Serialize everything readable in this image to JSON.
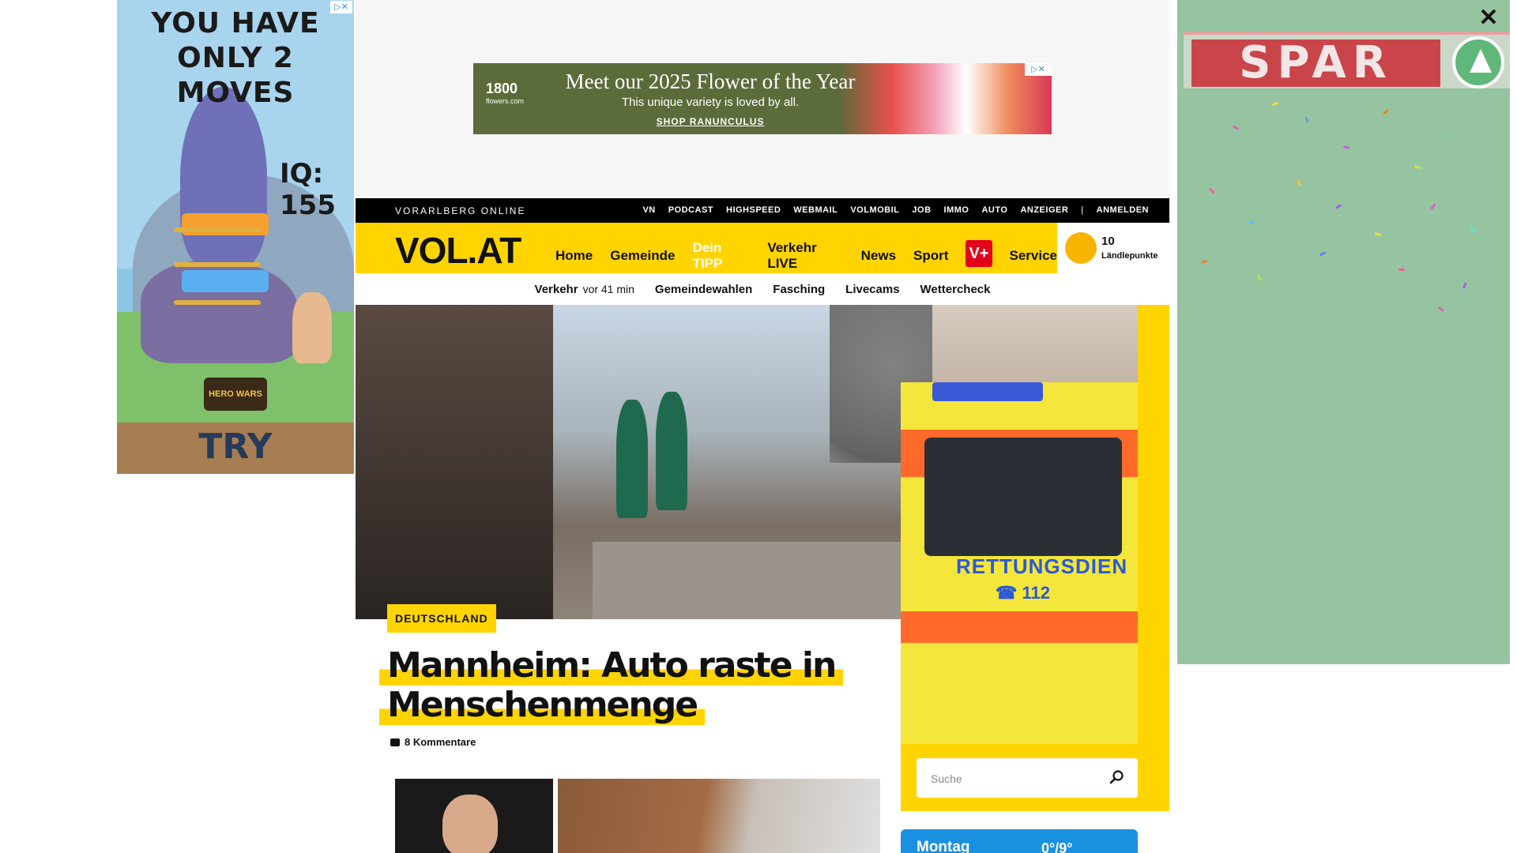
{
  "left_ad": {
    "headline_line1": "YOU HAVE",
    "headline_line2": "ONLY 2 MOVES",
    "iq_text": "IQ: 155",
    "brand": "HERO WARS",
    "cta": "TRY",
    "adchoices": "▷✕"
  },
  "top_banner": {
    "brand": "1800",
    "brand_sub": "flowers.com",
    "title": "Meet our 2025 Flower of the Year",
    "subtitle": "This unique variety is loved by all.",
    "cta": "SHOP RANUNCULUS",
    "adchoices": "▷✕"
  },
  "right_ad": {
    "brand": "SPAR",
    "close_label": "✕"
  },
  "topstrip": {
    "site_name": "VORARLBERG ONLINE",
    "links": [
      "VN",
      "PODCAST",
      "HIGHSPEED",
      "WEBMAIL",
      "VOLMOBIL",
      "JOB",
      "IMMO",
      "AUTO",
      "ANZEIGER"
    ],
    "separator": "|",
    "login": "ANMELDEN"
  },
  "mainnav": {
    "logo": "VOL.AT",
    "items": [
      "Home",
      "Gemeinde",
      "Dein TIPP",
      "Verkehr LIVE",
      "News",
      "Sport"
    ],
    "vplus": "V+",
    "service": "Service"
  },
  "points": {
    "count": "10",
    "label": "Ländlepunkte"
  },
  "subnav": {
    "verkehr_label": "Verkehr",
    "verkehr_time": "vor 41 min",
    "items": [
      "Gemeindewahlen",
      "Fasching",
      "Livecams",
      "Wettercheck"
    ]
  },
  "hero": {
    "ambulance_text": "RETTUNGSDIEN",
    "ambulance_phone": "☎ 112"
  },
  "article": {
    "category": "DEUTSCHLAND",
    "headline_line1": "Mannheim: Auto raste in",
    "headline_line2": "Menschenmenge",
    "comments": "8 Kommentare"
  },
  "sidebar": {
    "search_placeholder": "Suche",
    "weather_day": "Montag",
    "weather_temp": "0°/9°"
  },
  "colors": {
    "brand_yellow": "#ffd400",
    "vplus_red": "#e3001b",
    "weather_blue": "#1a90e0"
  }
}
